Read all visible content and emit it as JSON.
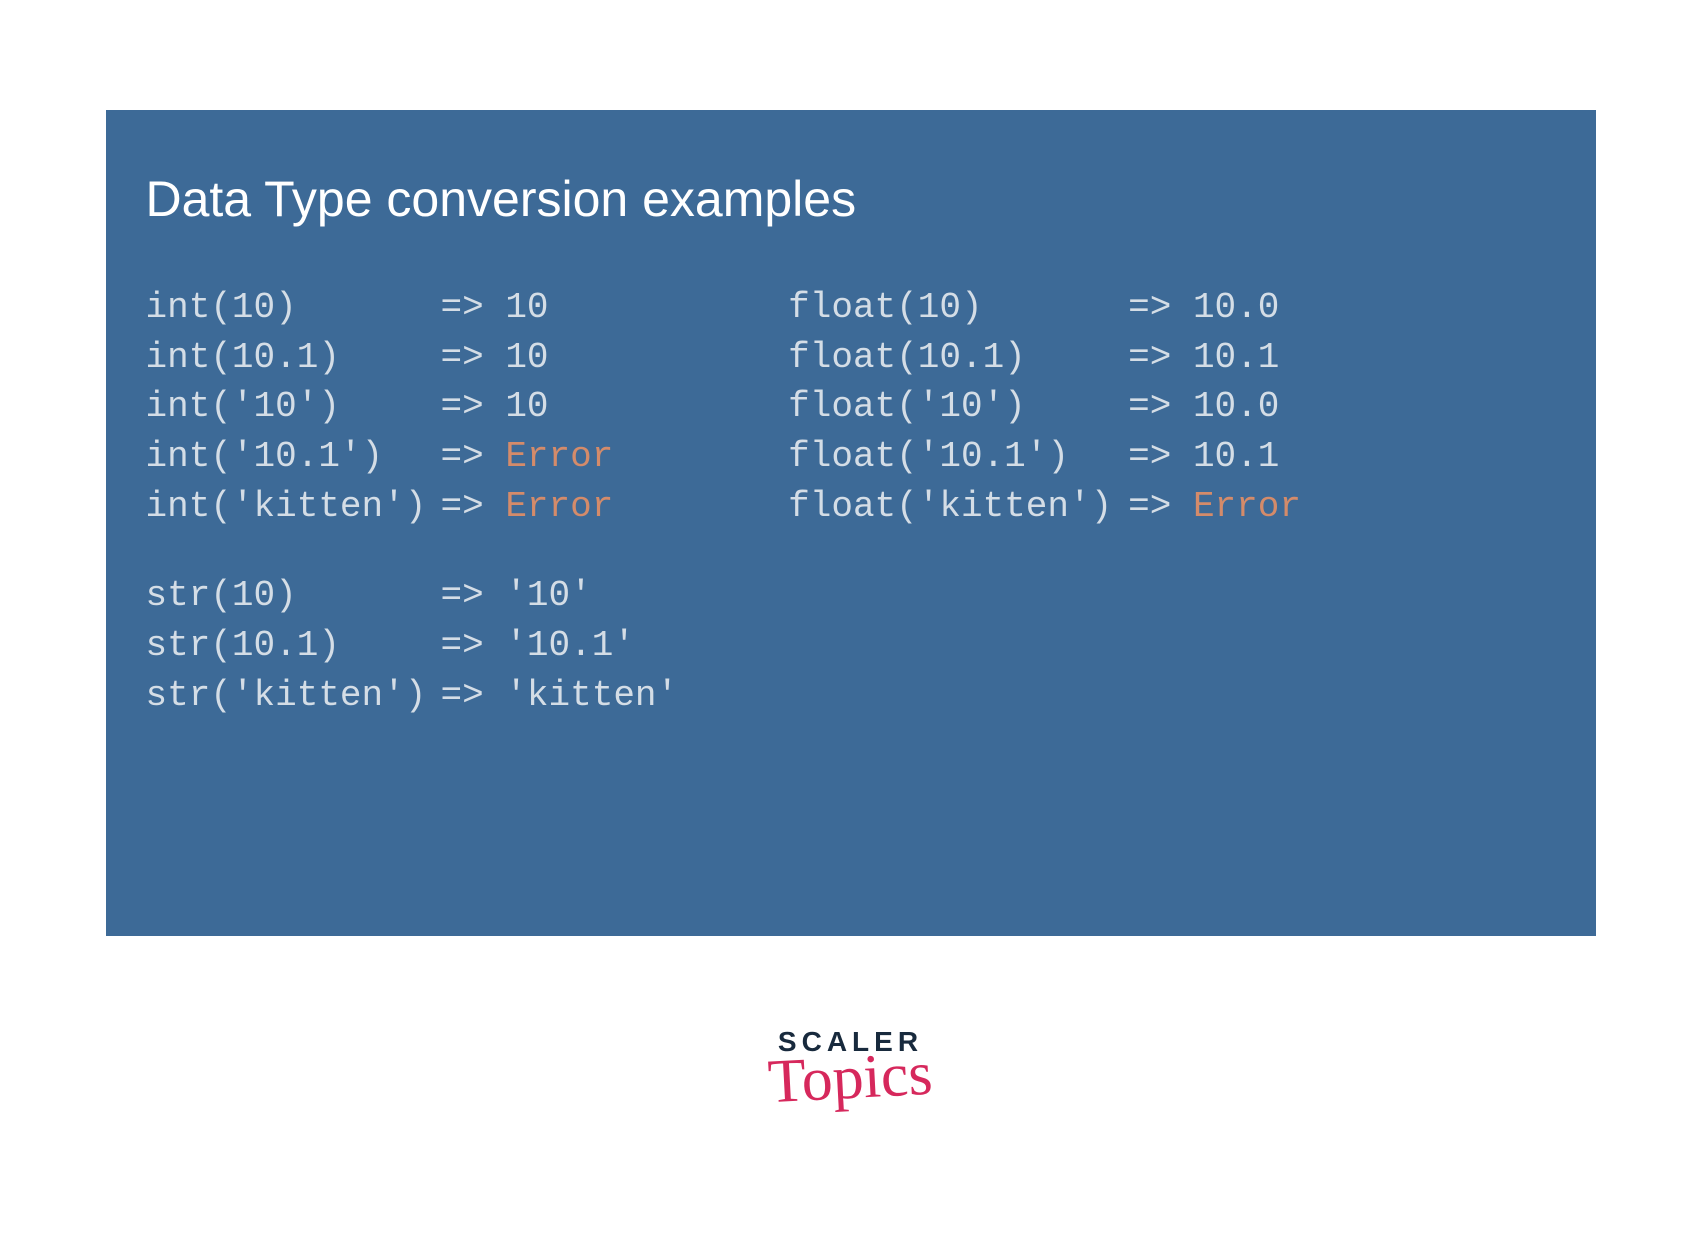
{
  "title": "Data Type conversion examples",
  "arrow": "=> ",
  "left": {
    "group1": [
      {
        "expr": "int(10)",
        "result": "10",
        "error": false
      },
      {
        "expr": "int(10.1)",
        "result": "10",
        "error": false
      },
      {
        "expr": "int('10')",
        "result": "10",
        "error": false
      },
      {
        "expr": "int('10.1')",
        "result": "Error",
        "error": true
      },
      {
        "expr": "int('kitten')",
        "result": "Error",
        "error": true
      }
    ],
    "group2": [
      {
        "expr": "str(10)",
        "result": "'10'",
        "error": false
      },
      {
        "expr": "str(10.1)",
        "result": "'10.1'",
        "error": false
      },
      {
        "expr": "str('kitten')",
        "result": "'kitten'",
        "error": false
      }
    ]
  },
  "right": {
    "group1": [
      {
        "expr": "float(10)",
        "result": "10.0",
        "error": false
      },
      {
        "expr": "float(10.1)",
        "result": "10.1",
        "error": false
      },
      {
        "expr": "float('10')",
        "result": "10.0",
        "error": false
      },
      {
        "expr": "float('10.1')",
        "result": "10.1",
        "error": false
      },
      {
        "expr": "float('kitten')",
        "result": "Error",
        "error": true
      }
    ]
  },
  "logo": {
    "line1": "SCALER",
    "line2": "Topics"
  }
}
